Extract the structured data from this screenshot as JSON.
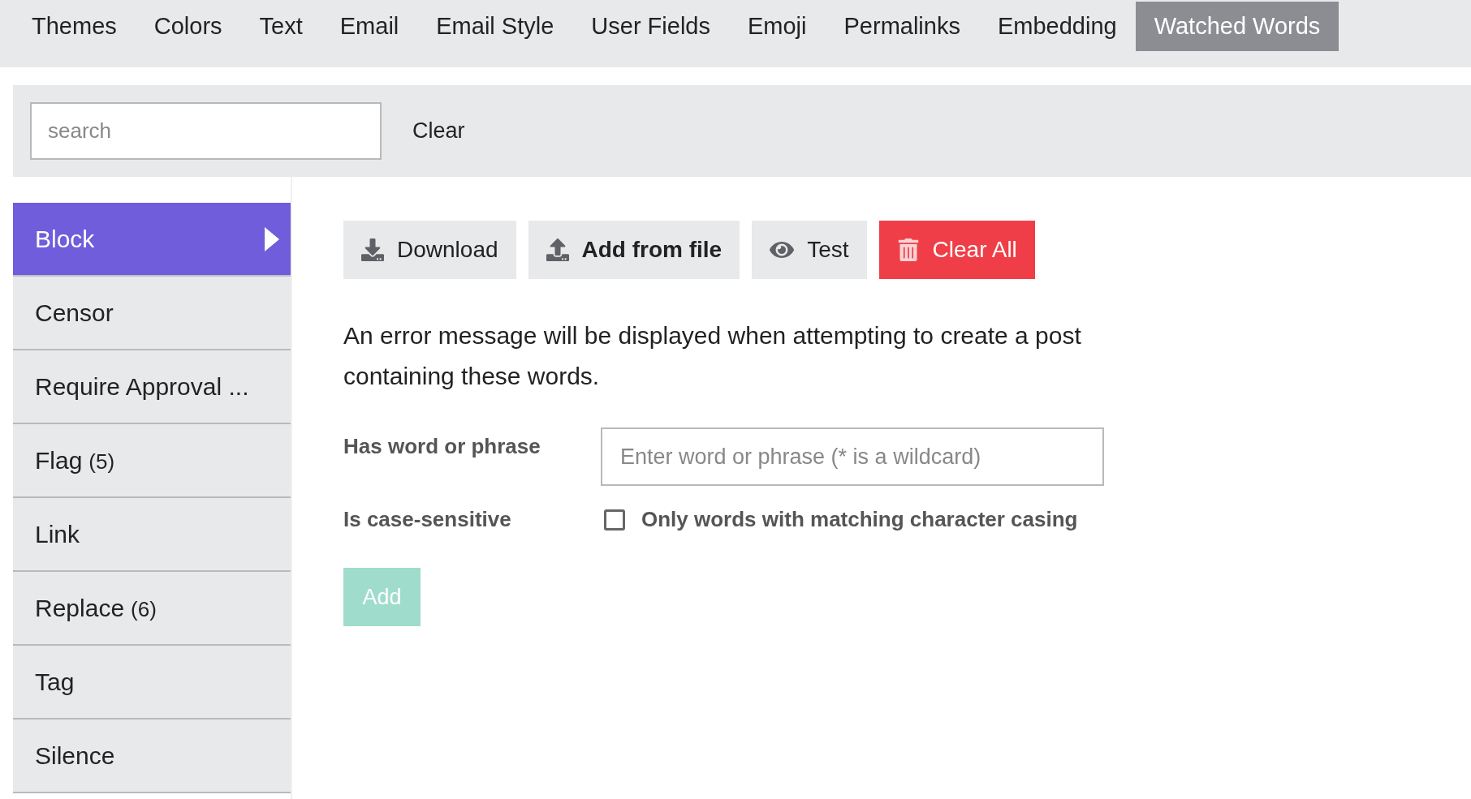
{
  "tabs": [
    {
      "label": "Themes",
      "selected": false
    },
    {
      "label": "Colors",
      "selected": false
    },
    {
      "label": "Text",
      "selected": false
    },
    {
      "label": "Email",
      "selected": false
    },
    {
      "label": "Email Style",
      "selected": false
    },
    {
      "label": "User Fields",
      "selected": false
    },
    {
      "label": "Emoji",
      "selected": false
    },
    {
      "label": "Permalinks",
      "selected": false
    },
    {
      "label": "Embedding",
      "selected": false
    },
    {
      "label": "Watched Words",
      "selected": true
    }
  ],
  "search": {
    "placeholder": "search",
    "clear": "Clear"
  },
  "sidebar": {
    "items": [
      {
        "label": "Block",
        "selected": true
      },
      {
        "label": "Censor",
        "selected": false
      },
      {
        "label": "Require Approval ...",
        "selected": false
      },
      {
        "label": "Flag",
        "count": "(5)",
        "selected": false
      },
      {
        "label": "Link",
        "selected": false
      },
      {
        "label": "Replace",
        "count": "(6)",
        "selected": false
      },
      {
        "label": "Tag",
        "selected": false
      },
      {
        "label": "Silence",
        "selected": false
      }
    ]
  },
  "actions": [
    {
      "label": "Download",
      "kind": "plain"
    },
    {
      "label": "Add from file",
      "kind": "bold"
    },
    {
      "label": "Test",
      "kind": "plain"
    },
    {
      "label": "Clear All",
      "kind": "danger"
    }
  ],
  "description": "An error message will be displayed when attempting to create a post containing these words.",
  "form": {
    "word_label": "Has word or phrase",
    "word_placeholder": "Enter word or phrase (* is a wildcard)",
    "case_label": "Is case-sensitive",
    "case_option": "Only words with matching character casing",
    "case_checked": false,
    "add": {
      "label": "Add",
      "disabled": true
    }
  }
}
